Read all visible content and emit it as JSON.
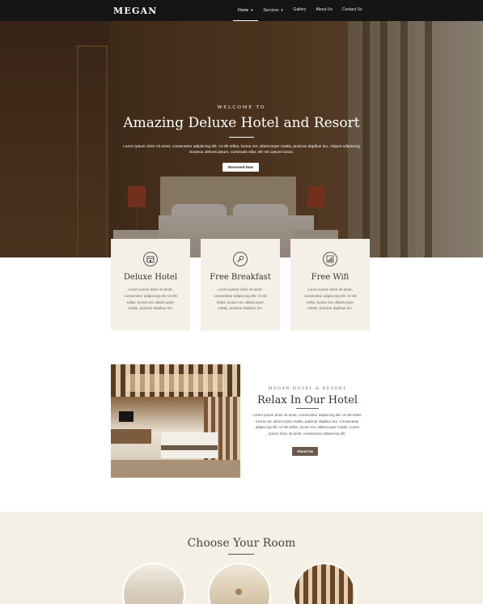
{
  "nav": {
    "brand": "MEGAN",
    "items": [
      {
        "label": "Home",
        "has_caret": true,
        "active": true
      },
      {
        "label": "Services",
        "has_caret": true,
        "active": false
      },
      {
        "label": "Gallery",
        "has_caret": false,
        "active": false
      },
      {
        "label": "About Us",
        "has_caret": false,
        "active": false
      },
      {
        "label": "Contact Us",
        "has_caret": false,
        "active": false
      }
    ],
    "caret_icon": "chevron-down-icon"
  },
  "hero": {
    "kicker": "WELCOME TO",
    "title": "Amazing Deluxe Hotel and Resort",
    "text": "Lorem ipsum dolor sit amet, consectetur adipiscing elit. Ut elit tellus, luctus nec ullamcorper mattis, pulvinar dapibus leo. Aliquet adipiscing vivamus ultrices ipsum, commodo eilar, elit nec ipsum luctus.",
    "button": "Reserved Now"
  },
  "features": [
    {
      "icon": "hotel-icon",
      "title": "Deluxe Hotel",
      "text": "Lorem ipsum dolor sit amet, consectetur adipiscing elit. Ut elit tellus, luctus nec ullamcorper mattis, pulvinar dapibus leo."
    },
    {
      "icon": "cutlery-icon",
      "title": "Free Breakfast",
      "text": "Lorem ipsum dolor sit amet, consectetur adipiscing elit. Ut elit tellus, luctus nec ullamcorper mattis, pulvinar dapibus leo."
    },
    {
      "icon": "wifi-icon",
      "title": "Free Wifi",
      "text": "Lorem ipsum dolor sit amet, consectetur adipiscing elit. Ut elit tellus, luctus nec ullamcorper mattis, pulvinar dapibus leo."
    }
  ],
  "about": {
    "kicker": "MEGAN HOTEL & RESORT",
    "title": "Relax In Our Hotel",
    "text": "Lorem ipsum dolor sit amet, consectetur adipiscing elit. Ut elit tellus, luctus nec ullamcorper mattis, pulvinar dapibus leo. Consectetur adipiscing elit. Ut elit tellus, luctus nec ullamcorper mattis. Lorem ipsum dolor sit amet, consectetur adipiscing elit.",
    "button": "About Us"
  },
  "rooms": {
    "title": "Choose Your Room"
  },
  "colors": {
    "nav_bg": "#151515",
    "feature_bg": "#f4f0e8",
    "accent_button": "#6b5a4b",
    "rooms_bg": "#f5f0e6"
  }
}
